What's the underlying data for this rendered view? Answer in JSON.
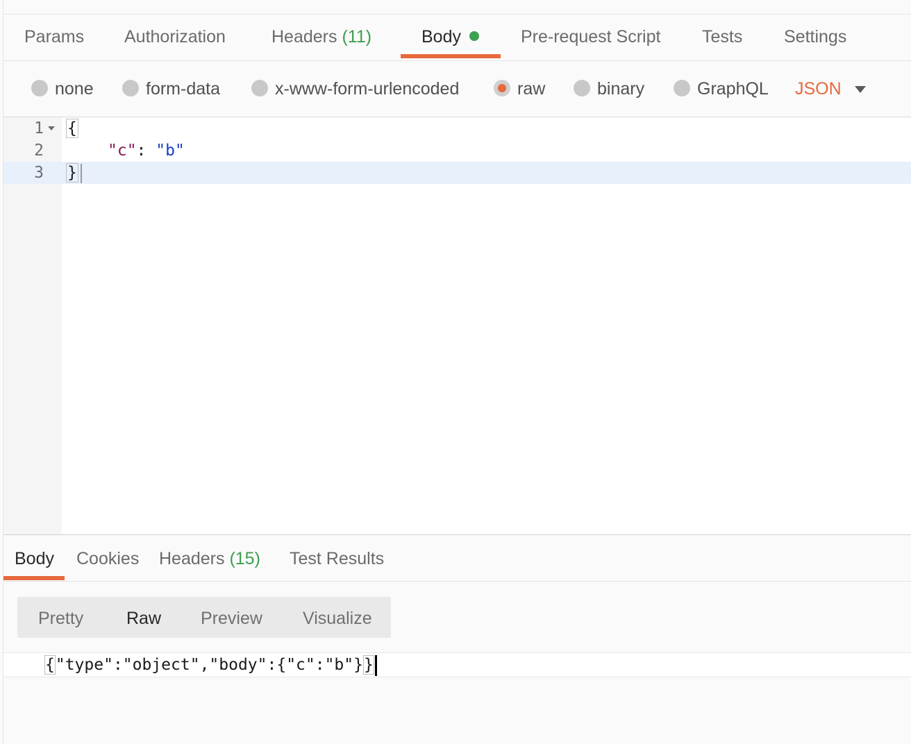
{
  "request_tabs": {
    "params": "Params",
    "authorization": "Authorization",
    "headers": "Headers",
    "headers_count": "(11)",
    "body": "Body",
    "pre_request_script": "Pre-request Script",
    "tests": "Tests",
    "settings": "Settings"
  },
  "body_types": {
    "none": "none",
    "form_data": "form-data",
    "urlencoded": "x-www-form-urlencoded",
    "raw": "raw",
    "binary": "binary",
    "graphql": "GraphQL",
    "format": "JSON",
    "selected": "raw"
  },
  "editor": {
    "lines": [
      {
        "num": "1",
        "text": "{"
      },
      {
        "num": "2",
        "key": "\"c\"",
        "sep": ": ",
        "value": "\"b\""
      },
      {
        "num": "3",
        "text": "}"
      }
    ],
    "active_line": "3"
  },
  "response_tabs": {
    "body": "Body",
    "cookies": "Cookies",
    "headers": "Headers",
    "headers_count": "(15)",
    "test_results": "Test Results"
  },
  "view_modes": {
    "pretty": "Pretty",
    "raw": "Raw",
    "preview": "Preview",
    "visualize": "Visualize",
    "selected": "Raw"
  },
  "response": {
    "open": "{",
    "middle": "\"type\":\"object\",\"body\":{\"c\":\"b\"}",
    "close": "}"
  },
  "colors": {
    "accent": "#e8693c",
    "count_green": "#3c9e50",
    "json_key": "#8b1a5a",
    "json_string": "#1a3ec8"
  }
}
